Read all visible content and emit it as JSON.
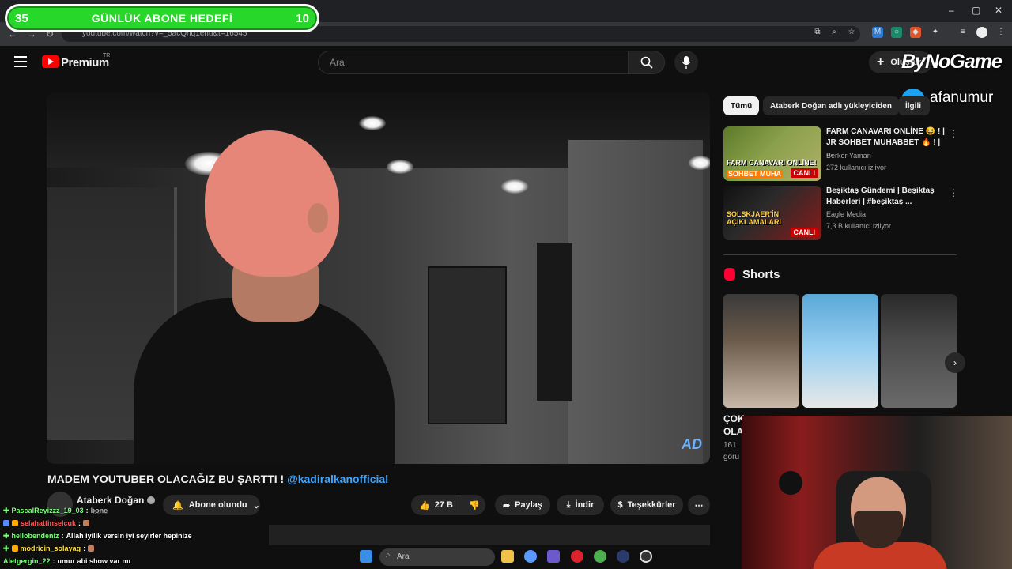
{
  "browser": {
    "url": "youtube.com/watch?v=_5acQhq1ehu&t=16545",
    "window_controls": [
      "–",
      "▢",
      "✕"
    ]
  },
  "overlay": {
    "goal_left": "35",
    "goal_title": "GÜNLÜK ABONE HEDEFİ",
    "goal_right": "10",
    "brand": "ByNoGame",
    "twitter_handle": "afanumur"
  },
  "masthead": {
    "brand": "Premium",
    "country": "TR",
    "search_placeholder": "Ara",
    "create_label": "Oluştur"
  },
  "video": {
    "watermark": "AD",
    "title_main": "MADEM YOUTUBER OLACAĞIZ BU ŞARTTI ! ",
    "title_mention": "@kadiralkanofficial",
    "channel_name": "Ataberk Doğan",
    "channel_subs": "bone",
    "subscribe_label": "Abone olundu",
    "like_count": "27 B",
    "share_label": "Paylaş",
    "download_label": "İndir",
    "thanks_label": "Teşekkürler"
  },
  "sidebar": {
    "chips": [
      "Tümü",
      "Ataberk Doğan adlı yükleyiciden",
      "İlgili"
    ],
    "recommendations": [
      {
        "thumb_caption": "FARM CANAVARI ONLİNE!",
        "thumb_caption2": "SOHBET MUHA",
        "live_label": "CANLI",
        "title": "FARM CANAVARI ONLİNE 😆 ! | JR SOHBET MUHABBET 🔥 ! | ...",
        "channel": "Berker Yaman",
        "meta": "272 kullanıcı izliyor"
      },
      {
        "thumb_caption": "SOLSKJAER'İN AÇIKLAMALARI",
        "thumb_caption2": "",
        "live_label": "CANLI",
        "title": "Beşiktaş Gündemi | Beşiktaş Haberleri | #beşiktaş ...",
        "channel": "Eagle Media",
        "meta": "7,3 B kullanıcı izliyor"
      }
    ],
    "shorts_title": "Shorts",
    "shorts_partial_title_1": "ÇOK",
    "shorts_partial_title_2": "OLA",
    "shorts_partial_views": "161",
    "shorts_partial_views2": "görü"
  },
  "chat": [
    {
      "user": "PascalReyizzz_19_03",
      "msg": "bone",
      "color": "#7cff7c"
    },
    {
      "user": "selahattinselcuk",
      "msg": "",
      "color": "#ff5a5a"
    },
    {
      "user": "hellobendeniz",
      "msg": "Allah iyilik versin iyi seyirler hepinize",
      "color": "#7cff7c"
    },
    {
      "user": "modricin_solayag",
      "msg": "",
      "color": "#ffe04a"
    },
    {
      "user": "Aletgergin_22",
      "msg": "umur abi show var mı",
      "color": "#7cff7c"
    }
  ],
  "taskbar": {
    "search_placeholder": "Ara"
  },
  "colors": {
    "accent": "#3ea6ff",
    "goal": "#27d72a",
    "live": "#cc0000",
    "yt_red": "#ff0000"
  }
}
